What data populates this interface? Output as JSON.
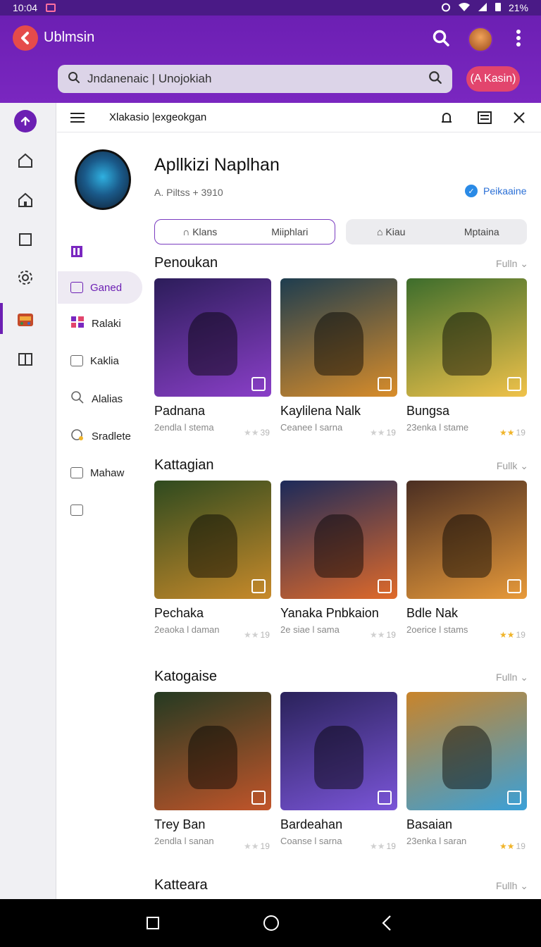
{
  "status_bar": {
    "time": "10:04",
    "battery": "21%"
  },
  "app": {
    "title": "Ublmsin",
    "search_value": "Jndanenaic | Unojokiah",
    "action_button": "(A Kasin)"
  },
  "panel": {
    "title": "Xlakasio |exgeokgan"
  },
  "profile": {
    "name": "Apllkizi Naplhan",
    "meta": "A. Piltss + 3910",
    "verified_label": "Peikaaine"
  },
  "tabs": {
    "outlined": [
      "Klans",
      "Miiphlari"
    ],
    "filled": [
      "Kiau",
      "Mptaina"
    ]
  },
  "subnav": [
    {
      "label": ""
    },
    {
      "label": "Ganed"
    },
    {
      "label": "Ralaki"
    },
    {
      "label": "Kaklia"
    },
    {
      "label": "Alalias"
    },
    {
      "label": "Sradlete"
    },
    {
      "label": "Mahaw"
    },
    {
      "label": ""
    }
  ],
  "sections": [
    {
      "title": "Penoukan",
      "more": "Fulln ⌄",
      "cards": [
        {
          "name": "Padnana",
          "sub": "2endla l stema",
          "rating": "39",
          "star": "dim",
          "bg": [
            "#2c1d5a",
            "#8a3fc8"
          ]
        },
        {
          "name": "Kaylilena Nalk",
          "sub": "Ceanee l sarna",
          "rating": "19",
          "star": "dim",
          "bg": [
            "#1e3d4f",
            "#d98d2a"
          ]
        },
        {
          "name": "Bungsa",
          "sub": "23enka l stame",
          "rating": "19",
          "star": "gold",
          "bg": [
            "#3d6d2c",
            "#f0c24a"
          ]
        }
      ]
    },
    {
      "title": "Kattagian",
      "more": "Fullk ⌄",
      "cards": [
        {
          "name": "Pechaka",
          "sub": "2eaoka l daman",
          "rating": "19",
          "star": "dim",
          "bg": [
            "#2e4a1f",
            "#c88a2a"
          ]
        },
        {
          "name": "Yanaka Pnbkaion",
          "sub": "2e siae l sama",
          "rating": "19",
          "star": "dim",
          "bg": [
            "#1c2a5a",
            "#e06a2a"
          ]
        },
        {
          "name": "Bdle Nak",
          "sub": "2oerice l stams",
          "rating": "19",
          "star": "gold",
          "bg": [
            "#4a2e22",
            "#e89a3a"
          ]
        }
      ]
    },
    {
      "title": "Katogaise",
      "more": "Fulln ⌄",
      "cards": [
        {
          "name": "Trey Ban",
          "sub": "2endla l sanan",
          "rating": "19",
          "star": "dim",
          "bg": [
            "#243a22",
            "#c2552a"
          ]
        },
        {
          "name": "Bardeahan",
          "sub": "Coanse l sarna",
          "rating": "19",
          "star": "dim",
          "bg": [
            "#2a225a",
            "#7a55d8"
          ]
        },
        {
          "name": "Basaian",
          "sub": "23enka l saran",
          "rating": "19",
          "star": "gold",
          "bg": [
            "#c9842a",
            "#3aa0d8"
          ]
        }
      ]
    },
    {
      "title": "Katteara",
      "more": "Fullh ⌄",
      "cards": []
    }
  ]
}
